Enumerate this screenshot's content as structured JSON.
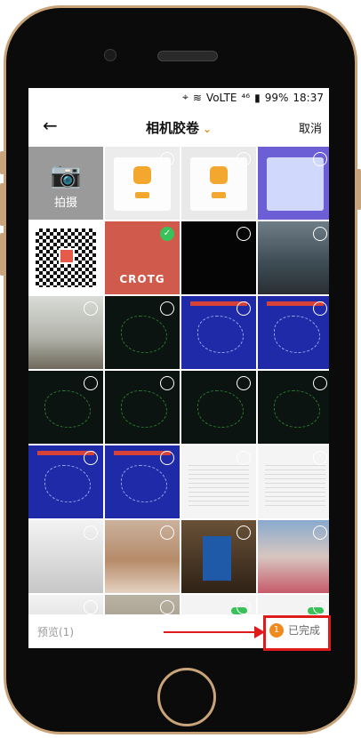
{
  "statusbar": {
    "volte": "VoLTE",
    "signal": "⁴⁶",
    "battery": "99%",
    "time": "18:37"
  },
  "header": {
    "back_icon": "←",
    "title": "相机胶卷",
    "dropdown_icon": "⌄",
    "cancel": "取消"
  },
  "grid": {
    "camera_label": "拍摄",
    "crotg_label": "CROTG"
  },
  "bottom": {
    "preview": "预览(1)",
    "badge": "1",
    "done": "已完成"
  },
  "annotation": {
    "color": "#e01b1b"
  }
}
